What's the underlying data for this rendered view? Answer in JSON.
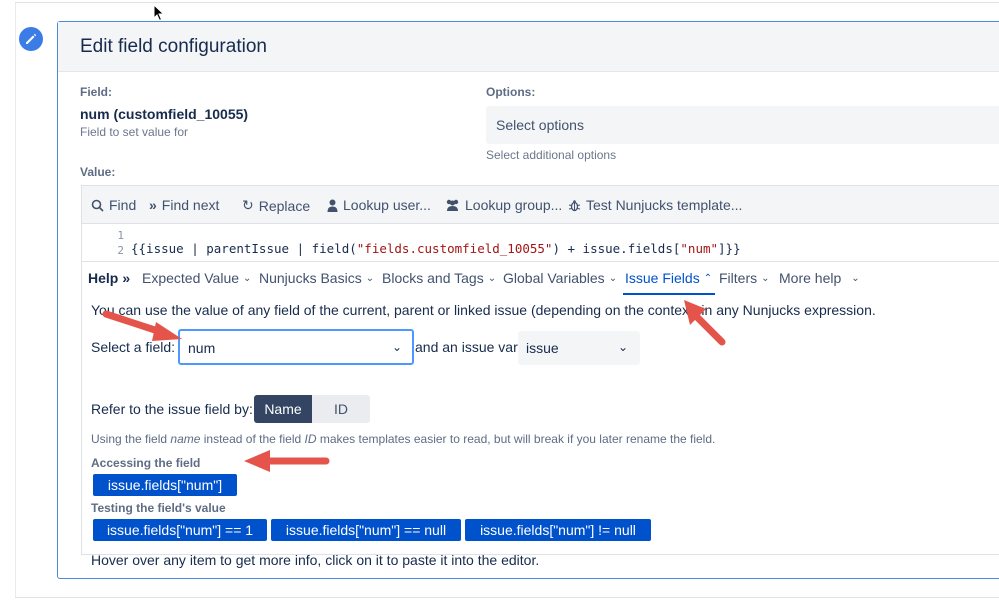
{
  "panel": {
    "title": "Edit field configuration"
  },
  "field": {
    "label": "Field:",
    "name": "num (customfield_10055)",
    "helper": "Field to set value for"
  },
  "options": {
    "label": "Options:",
    "placeholder": "Select options",
    "helper": "Select additional options"
  },
  "value": {
    "label": "Value:"
  },
  "toolbar": {
    "items": [
      {
        "icon": "search-icon",
        "label": "Find"
      },
      {
        "icon": "double-chevron-right-icon",
        "label": "Find next"
      },
      {
        "icon": "replace-icon",
        "label": "Replace"
      },
      {
        "icon": "user-icon",
        "label": "Lookup user..."
      },
      {
        "icon": "users-icon",
        "label": "Lookup group..."
      },
      {
        "icon": "bug-icon",
        "label": "Test Nunjucks template..."
      }
    ]
  },
  "editor": {
    "line_numbers": [
      "1",
      "2"
    ],
    "code_prefix": "{{issue | parentIssue | field(",
    "code_str1": "\"fields.customfield_10055\"",
    "code_mid": ") + issue.fields[",
    "code_str2": "\"num\"",
    "code_suffix": "]}}"
  },
  "help": {
    "title": "Help",
    "tabs": [
      {
        "label": "Expected Value"
      },
      {
        "label": "Nunjucks Basics"
      },
      {
        "label": "Blocks and Tags"
      },
      {
        "label": "Global Variables"
      },
      {
        "label": "Issue Fields"
      },
      {
        "label": "Filters"
      },
      {
        "label": "More help"
      }
    ],
    "intro": "You can use the value of any field of the current, parent or linked issue (depending on the context) in any Nunjucks expression.",
    "select_field_label": "Select a field:",
    "select_field_value": "num",
    "issue_var_label": "and an issue var:",
    "issue_var_value": "issue",
    "refer_label": "Refer to the issue field by:",
    "refer_options": [
      "Name",
      "ID"
    ],
    "note_prefix": "Using the field ",
    "note_em1": "name",
    "note_mid": " instead of the field ",
    "note_em2": "ID",
    "note_suffix": " makes templates easier to read, but will break if you later rename the field.",
    "accessing_label": "Accessing the field",
    "accessing_chip": "issue.fields[\"num\"]",
    "testing_label": "Testing the field's value",
    "testing_chips": [
      "issue.fields[\"num\"] == 1",
      "issue.fields[\"num\"] == null",
      "issue.fields[\"num\"] != null"
    ],
    "footer": "Hover over any item to get more info, click on it to paste it into the editor."
  },
  "colors": {
    "accent": "#0052cc",
    "annotation_arrow": "#e5544b"
  }
}
